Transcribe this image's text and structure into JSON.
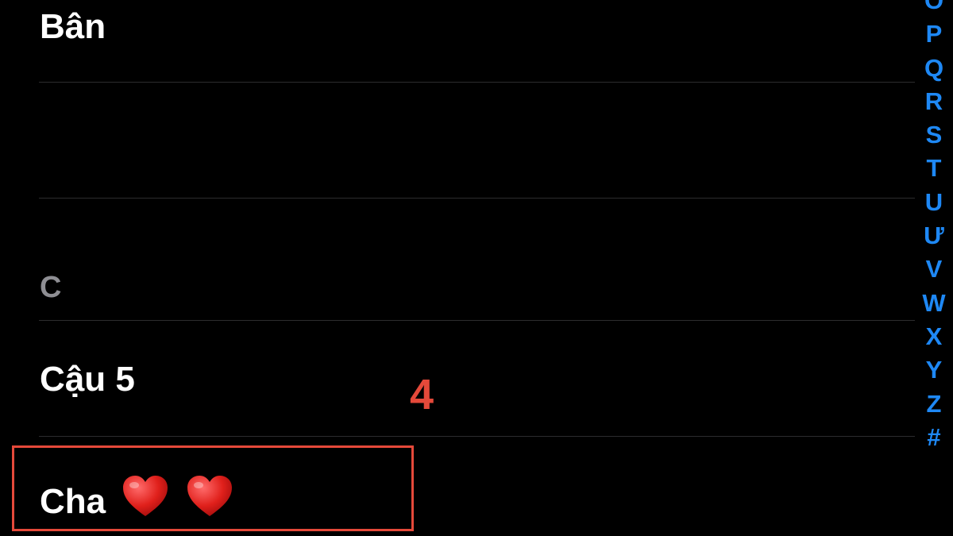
{
  "contacts": {
    "rows": [
      {
        "label": "Bân"
      },
      {
        "label": "Cậu 5"
      },
      {
        "label": "Cha"
      }
    ],
    "section_header": "C",
    "hearts": [
      "heart-icon",
      "heart-icon"
    ]
  },
  "annotation": {
    "step_number": "4",
    "color": "#e5493a"
  },
  "index": {
    "letters": [
      "O",
      "P",
      "Q",
      "R",
      "S",
      "T",
      "U",
      "Ư",
      "V",
      "W",
      "X",
      "Y",
      "Z",
      "#"
    ],
    "color": "#1e88f5"
  }
}
